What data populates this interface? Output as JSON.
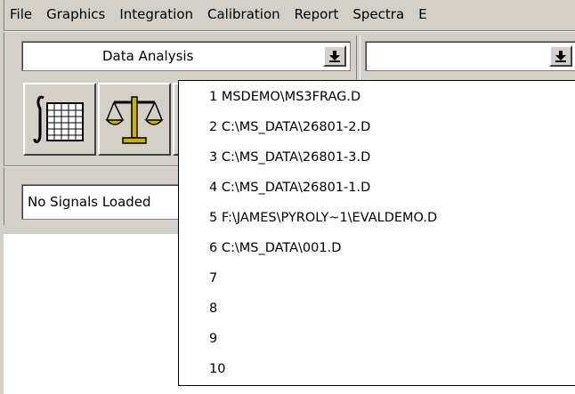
{
  "menu": {
    "items": [
      "File",
      "Graphics",
      "Integration",
      "Calibration",
      "Report",
      "Spectra",
      "E"
    ]
  },
  "combo_left": {
    "value": "Data Analysis",
    "button_icon": "down-arrow-icon"
  },
  "combo_right": {
    "value": "",
    "button_icon": "down-arrow-icon"
  },
  "toolbar": {
    "buttons": [
      {
        "icon": "integrate-table-icon"
      },
      {
        "icon": "balance-scale-icon"
      },
      {
        "icon": "spectrum-icon"
      }
    ]
  },
  "signals": {
    "text": "No Signals Loaded"
  },
  "recent_files": {
    "items": [
      "1 MSDEMO\\MS3FRAG.D",
      "2 C:\\MS_DATA\\26801-2.D",
      "3 C:\\MS_DATA\\26801-3.D",
      "4 C:\\MS_DATA\\26801-1.D",
      "5 F:\\JAMES\\PYROLY~1\\EVALDEMO.D",
      "6 C:\\MS_DATA\\001.D",
      "7",
      "8",
      "9",
      "10"
    ]
  },
  "colors": {
    "face": "#d4d0c8",
    "window": "#ffffff",
    "spectrum_line": "#0000ff"
  }
}
